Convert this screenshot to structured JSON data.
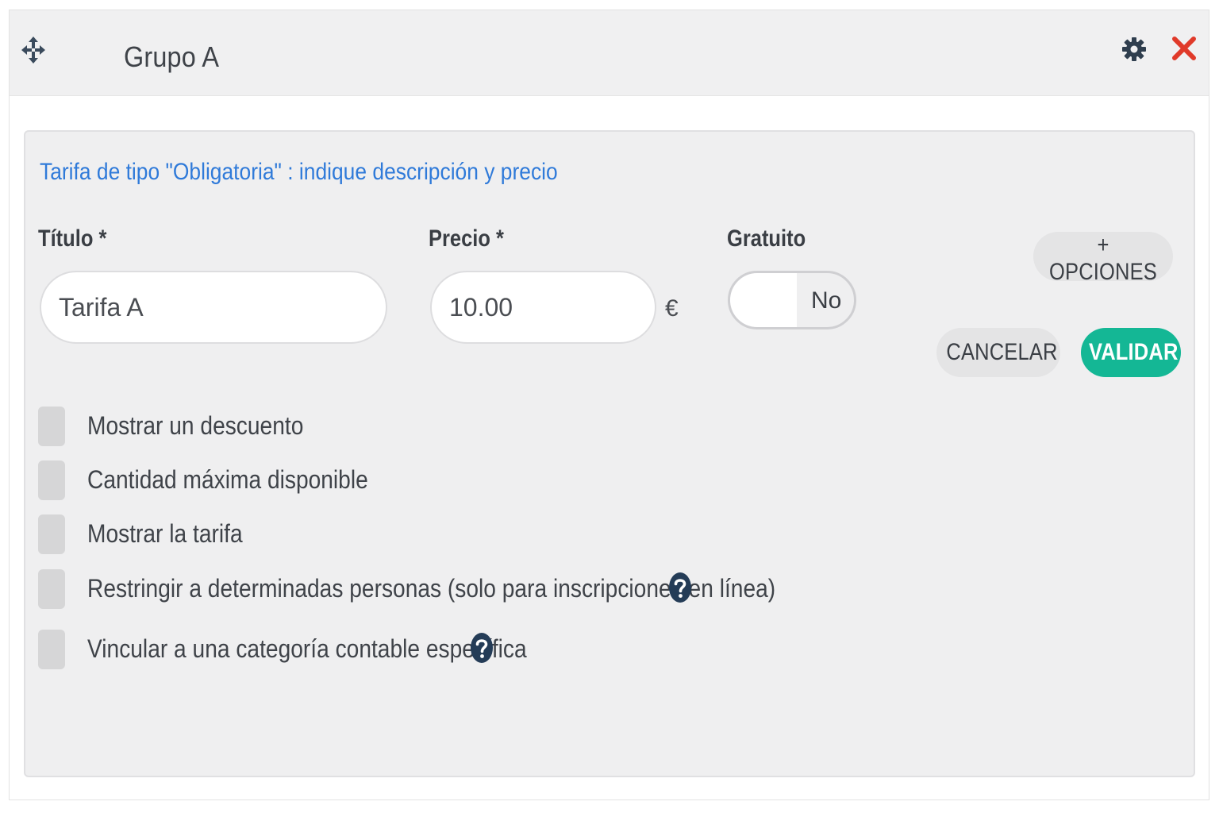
{
  "header": {
    "title": "Grupo A",
    "icons": [
      "move-icon",
      "gear-icon",
      "close-icon"
    ],
    "close_color": "#e03a2a"
  },
  "panel": {
    "info_text": "Tarifa de tipo \"Obligatoria\" : indique descripción y precio",
    "titulo_label": "Título *",
    "titulo_value": "Tarifa A",
    "precio_label": "Precio *",
    "precio_value": "10.00",
    "currency": "€",
    "gratuito_label": "Gratuito",
    "gratuito_toggle_text": "No",
    "opciones_button": "+ OPCIONES",
    "cancel_button": "CANCELAR",
    "validate_button": "VALIDAR",
    "validate_color": "#14b795",
    "info_color": "#2f7ad9"
  },
  "options": [
    {
      "label": "Mostrar un descuento",
      "checked": false
    },
    {
      "label": "Cantidad máxima disponible",
      "checked": false
    },
    {
      "label": "Mostrar la tarifa",
      "checked": false
    },
    {
      "label": "Restringir a determinadas personas (solo para inscripciones en línea)",
      "checked": false,
      "help": "help-icon"
    },
    {
      "label": "Vincular a una categoría contable específica",
      "checked": false,
      "help": "help-icon"
    }
  ]
}
